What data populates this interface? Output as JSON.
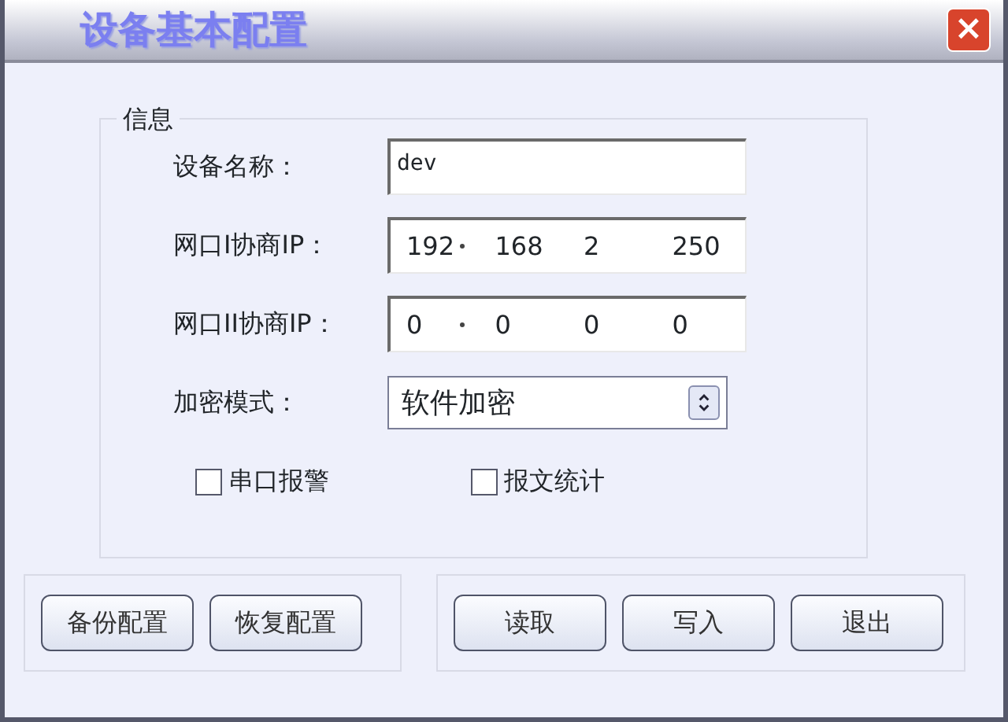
{
  "window": {
    "title": "设备基本配置",
    "close": "×"
  },
  "group": {
    "title": "信息",
    "name_field": {
      "label": "设备名称：",
      "value": "dev"
    },
    "ip_fields": [
      {
        "label": "网口I协商IP：",
        "octets": [
          {
            "value": "192",
            "dot_after": true
          },
          {
            "value": "168",
            "dot_after": false
          },
          {
            "value": "2",
            "dot_after": false
          },
          {
            "value": "250",
            "dot_after": false
          }
        ]
      },
      {
        "label": "网口II协商IP：",
        "octets": [
          {
            "value": "0",
            "dot_after": true
          },
          {
            "value": "0",
            "dot_after": false
          },
          {
            "value": "0",
            "dot_after": false
          },
          {
            "value": "0",
            "dot_after": false
          }
        ]
      }
    ],
    "mode": {
      "label": "加密模式：",
      "value": "软件加密"
    },
    "checkboxes": [
      {
        "label": "串口报警",
        "checked": false
      },
      {
        "label": "报文统计",
        "checked": false
      }
    ]
  },
  "left_buttons": [
    "备份配置",
    "恢复配置"
  ],
  "right_buttons": [
    "读取",
    "写入",
    "退出"
  ]
}
